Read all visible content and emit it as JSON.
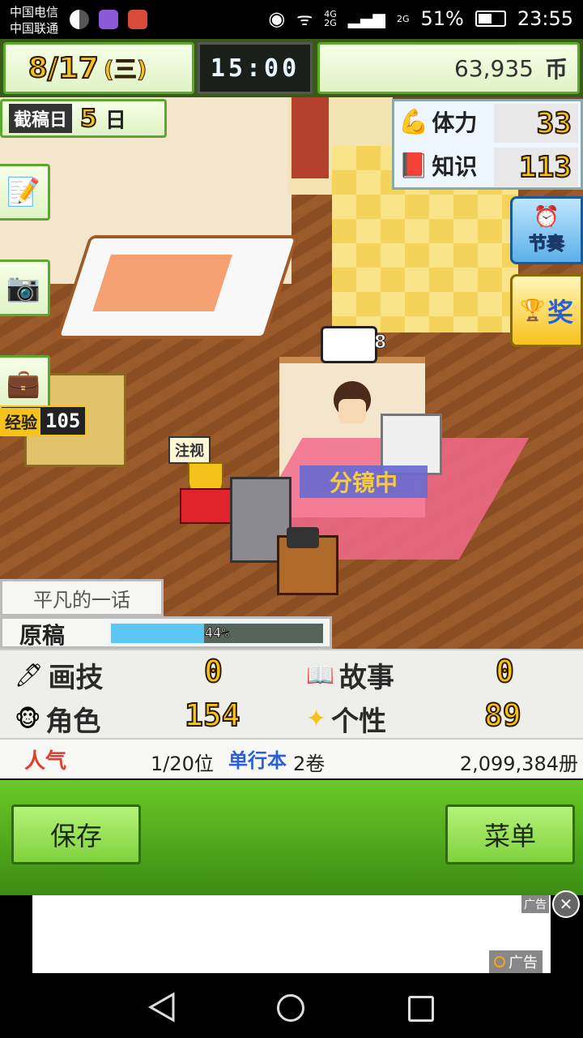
{
  "status_bar": {
    "carrier1": "中国电信",
    "carrier2": "中国联通",
    "network_4g": "4G",
    "network_2g_a": "2G",
    "network_2g_b": "2G",
    "battery": "51%",
    "time": "23:55"
  },
  "hud": {
    "month": "8",
    "day": "/17",
    "weekday": "(三)",
    "clock": "15:00",
    "money": "63,935",
    "currency": "币",
    "deadline_label": "截稿日",
    "deadline_days": "5",
    "deadline_unit": "日",
    "stamina_label": "体力",
    "stamina_value": "33",
    "knowledge_label": "知识",
    "knowledge_value": "113",
    "festival_label": "节奏",
    "award_label": "奖",
    "experience_label": "经验",
    "experience_value": "105",
    "trophy_label": "注视",
    "speech_count": "8",
    "status_label": "分镜中"
  },
  "manuscript": {
    "title": "平凡的一话",
    "label": "原稿",
    "progress_text": "44%",
    "progress": 0.44
  },
  "stats": {
    "art_label": "画技",
    "art_value": "0",
    "story_label": "故事",
    "story_value": "0",
    "character_label": "角色",
    "character_value": "154",
    "personality_label": "个性",
    "personality_value": "89",
    "popularity_label": "人气",
    "rank": "1/20位",
    "volume_label": "单行本",
    "volumes": "2卷",
    "sales": "2,099,384册"
  },
  "buttons": {
    "save": "保存",
    "menu": "菜单"
  },
  "ad": {
    "tag_top": "广告",
    "tag_bottom": "广告"
  },
  "colors": {
    "hud_green": "#5aa82c",
    "button_green": "#7fd23c",
    "stat_gold": "#f7c21b",
    "popularity_red": "#e63b2e",
    "volume_blue": "#2a5fd8",
    "progress_blue": "#5bc6f2"
  }
}
